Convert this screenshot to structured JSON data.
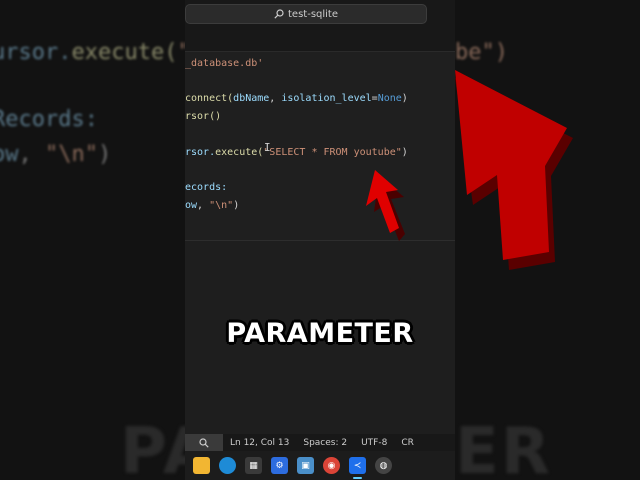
{
  "window": {
    "search_text": "test-sqlite"
  },
  "code_lines": [
    {
      "tokens": [
        {
          "t": "_database.db'",
          "c": "#ce9178"
        }
      ]
    },
    {
      "tokens": []
    },
    {
      "tokens": [
        {
          "t": "connect(",
          "c": "#dcdcaa"
        },
        {
          "t": "dbName",
          "c": "#9cdcfe"
        },
        {
          "t": ", ",
          "c": "#d4d4d4"
        },
        {
          "t": "isolation_level",
          "c": "#9cdcfe"
        },
        {
          "t": "=",
          "c": "#d4d4d4"
        },
        {
          "t": "None",
          "c": "#569cd6"
        },
        {
          "t": ")",
          "c": "#d4d4d4"
        }
      ]
    },
    {
      "tokens": [
        {
          "t": "rsor()",
          "c": "#dcdcaa"
        }
      ]
    },
    {
      "tokens": []
    },
    {
      "tokens": [
        {
          "t": "rsor.",
          "c": "#9cdcfe"
        },
        {
          "t": "execute(",
          "c": "#dcdcaa"
        },
        {
          "t": "\"SELECT * FROM youtube\"",
          "c": "#ce9178"
        },
        {
          "t": ")",
          "c": "#d4d4d4"
        }
      ]
    },
    {
      "tokens": []
    },
    {
      "tokens": [
        {
          "t": "ecords:",
          "c": "#9cdcfe"
        }
      ]
    },
    {
      "tokens": [
        {
          "t": "ow",
          "c": "#9cdcfe"
        },
        {
          "t": ", ",
          "c": "#d4d4d4"
        },
        {
          "t": "\"\\n\"",
          "c": "#ce9178"
        },
        {
          "t": ")",
          "c": "#d4d4d4"
        }
      ]
    }
  ],
  "bg_left_lines": [
    {
      "tokens": [
        {
          "t": "ursor.",
          "c": "#5b7a8c"
        },
        {
          "t": "execute(",
          "c": "#8a8a6a"
        },
        {
          "t": "\"",
          "c": "#8a6a5a"
        }
      ]
    },
    {
      "tokens": []
    },
    {
      "tokens": [
        {
          "t": "Records:",
          "c": "#5b7a8c"
        }
      ]
    },
    {
      "tokens": [
        {
          "t": "ow",
          "c": "#5b7a8c"
        },
        {
          "t": ", ",
          "c": "#777"
        },
        {
          "t": "\"\\n\"",
          "c": "#8a6a5a"
        },
        {
          "t": ")",
          "c": "#777"
        }
      ]
    }
  ],
  "bg_right_line": "be\")",
  "caption": "PARAMETER",
  "bg_caption_left": "PA",
  "bg_caption_right": "ER",
  "statusbar": {
    "position": "Ln 12, Col 13",
    "spaces": "Spaces: 2",
    "encoding": "UTF-8",
    "eol": "CR"
  },
  "taskbar_icons": [
    {
      "name": "file-explorer-icon",
      "color": "#f2b632",
      "glyph": ""
    },
    {
      "name": "edge-icon",
      "color": "#1e8bd6",
      "glyph": ""
    },
    {
      "name": "store-icon",
      "color": "#3a3a3a",
      "glyph": "▦"
    },
    {
      "name": "settings-app-icon",
      "color": "#2d6cdf",
      "glyph": "⚙"
    },
    {
      "name": "photos-icon",
      "color": "#4a8fc9",
      "glyph": "▣"
    },
    {
      "name": "chrome-icon",
      "color": "#db4437",
      "glyph": "◉"
    },
    {
      "name": "vscode-icon",
      "color": "#1f6feb",
      "glyph": "≺",
      "active": true
    },
    {
      "name": "obs-icon",
      "color": "#444",
      "glyph": "◍"
    }
  ],
  "colors": {
    "arrow": "#e00000",
    "arrow_shadow": "#3a0000",
    "accent": "#60cdff"
  }
}
